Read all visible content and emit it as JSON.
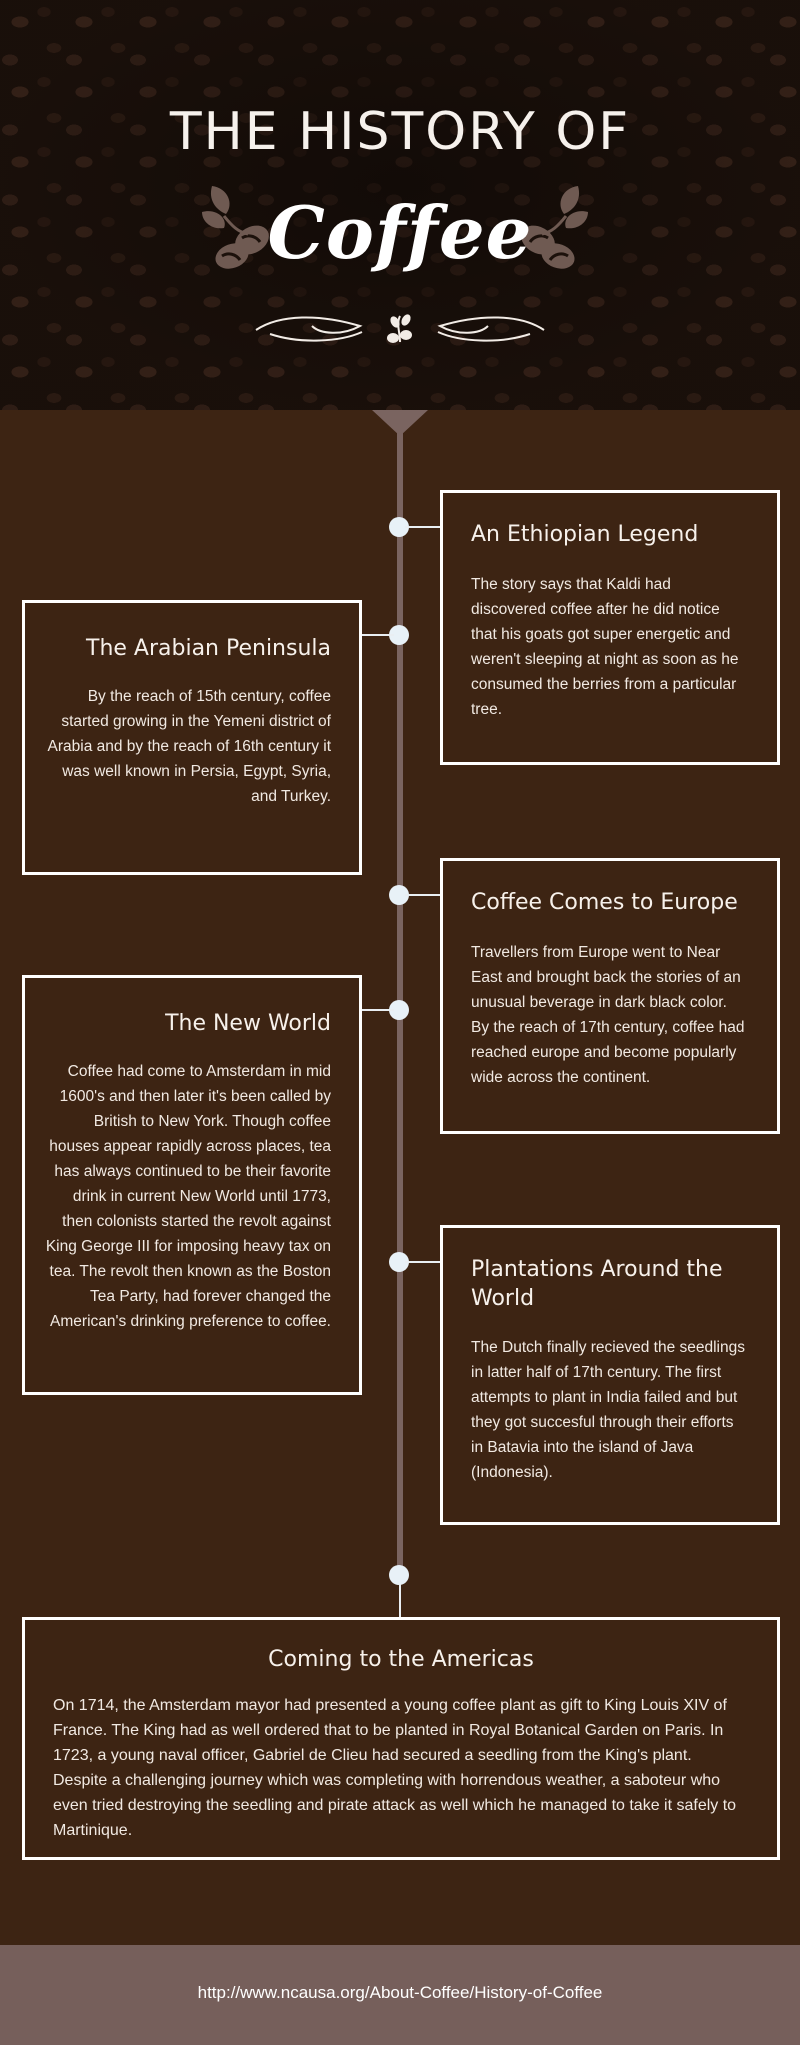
{
  "header": {
    "title": "THE HISTORY OF",
    "subtitle": "Coffee"
  },
  "colors": {
    "background": "#3d2413",
    "timeline": "#7a6460",
    "dot": "#e8f1f7",
    "footer": "#765f5b"
  },
  "timeline": [
    {
      "title": "An Ethiopian Legend",
      "text": "The story says that Kaldi had discovered coffee after he did notice that his goats got super energetic and weren't sleeping at night as soon as he consumed the berries from a particular tree."
    },
    {
      "title": "The Arabian Peninsula",
      "text": "By the reach of 15th century, coffee started growing in the Yemeni district of Arabia and by the  reach of 16th century it was well known in Persia, Egypt, Syria, and Turkey."
    },
    {
      "title": "Coffee Comes to Europe",
      "text": "Travellers from Europe went to Near East and brought back the stories of an unusual beverage in dark black color. By the reach of 17th century, coffee had reached europe and become popularly wide across the continent."
    },
    {
      "title": "The New World",
      "text": "Coffee had come to Amsterdam in mid 1600's and then later it's been called by British to New York. Though coffee houses appear rapidly across places, tea has always continued to be their favorite drink in current New World until 1773, then colonists started the revolt against  King George III for imposing heavy tax on tea. The revolt then known as the Boston Tea Party, had forever changed the American's drinking preference to coffee."
    },
    {
      "title": "Plantations Around the World",
      "text": "The Dutch finally recieved the seedlings in latter half of 17th century. The first attempts to plant in India failed and but they got succesful through their efforts in Batavia into the island of Java (Indonesia)."
    },
    {
      "title": "Coming to the Americas",
      "text": "On 1714, the Amsterdam mayor had presented a young coffee plant as gift to King Louis XIV of France. The King had as well ordered that to be planted in  Royal Botanical Garden on Paris. In 1723, a young naval officer, Gabriel de Clieu had secured a seedling from the King's plant. Despite a challenging journey which was completing with horrendous weather, a saboteur who even tried destroying the seedling and pirate attack as well which he managed to take it safely to Martinique."
    }
  ],
  "footer": {
    "link": "http://www.ncausa.org/About-Coffee/History-of-Coffee"
  }
}
